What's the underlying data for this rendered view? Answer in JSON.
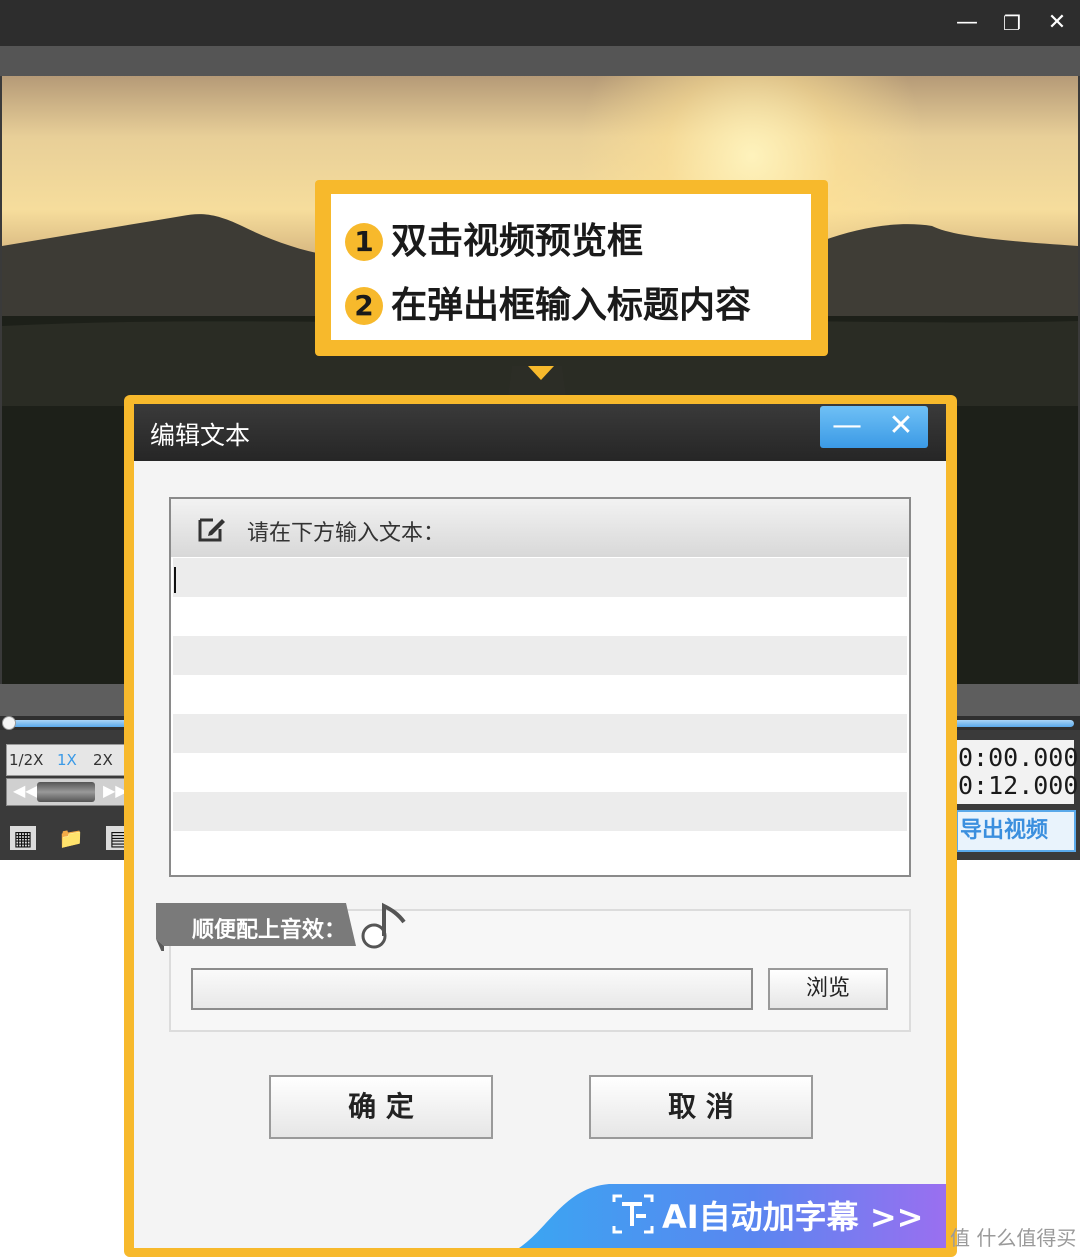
{
  "window": {
    "controls": {
      "minimize_icon": "minimize-icon",
      "restore_icon": "restore-icon",
      "close_icon": "close-icon"
    }
  },
  "player": {
    "speeds": [
      "1/2X",
      "1X",
      "2X"
    ],
    "selected_speed": "1X",
    "time_current": "0:00.000",
    "time_total": "0:12.000",
    "export_label": "导出视频",
    "playback_progress": 0
  },
  "callout": {
    "steps": [
      {
        "num": "1",
        "text": "双击视频预览框"
      },
      {
        "num": "2",
        "text": "在弹出框输入标题内容"
      }
    ],
    "accent": "#f7b92c"
  },
  "dialog": {
    "title": "编辑文本",
    "text_prompt": "请在下方输入文本：",
    "text_value": "",
    "audio_label": "顺便配上音效：",
    "audio_path_value": "",
    "browse_label": "浏览",
    "ok_label": "确 定",
    "cancel_label": "取 消",
    "ai_subtitle_label": "AI自动加字幕 >>"
  },
  "watermark": "值 什么值得买"
}
